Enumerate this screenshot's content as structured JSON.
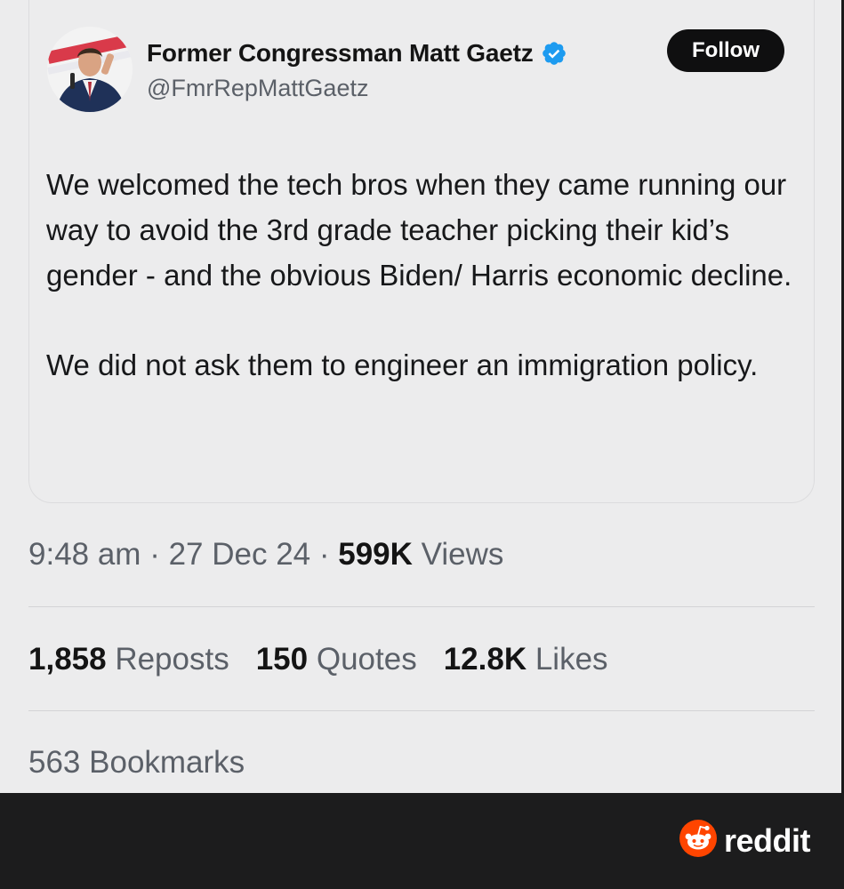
{
  "tweet": {
    "display_name": "Former Congressman Matt Gaetz",
    "handle": "@FmrRepMattGaetz",
    "follow_label": "Follow",
    "verified_icon": "verified-badge-icon",
    "paragraphs": [
      "We welcomed the tech bros when they came running our way to avoid the 3rd grade teacher picking their kid’s gender - and the obvious Biden/ Harris economic decline.",
      "We did not ask them to engineer an immigration policy."
    ],
    "time": "9:48 am",
    "sep1": " · ",
    "date": "27 Dec 24",
    "sep2": " · ",
    "views_count": "599K",
    "views_label": " Views",
    "reposts_count": "1,858",
    "reposts_label": " Reposts",
    "quotes_count": "150",
    "quotes_label": " Quotes",
    "likes_count": "12.8K",
    "likes_label": " Likes",
    "bookmarks_count": "563",
    "bookmarks_label": " Bookmarks"
  },
  "footer": {
    "brand": "reddit",
    "brand_icon": "reddit-snoo-icon"
  },
  "colors": {
    "background": "#ececed",
    "text": "#17181a",
    "muted": "#5b6068",
    "verified": "#1d9bf0",
    "follow_bg": "#0f0f10",
    "footer_bg": "#1c1c1d",
    "reddit_orange": "#ff4500"
  }
}
